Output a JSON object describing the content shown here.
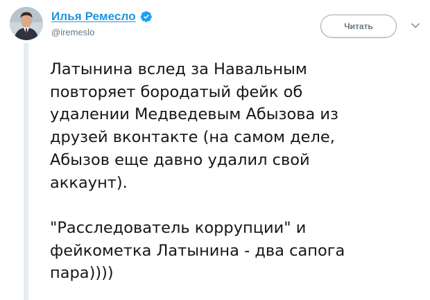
{
  "author": {
    "display_name": "Илья Ремесло",
    "handle": "@iremeslo",
    "verified": true
  },
  "follow_button": {
    "label": "Читать"
  },
  "tweet": {
    "paragraphs": [
      "Латынина вслед за Навальным\nповторяет бородатый фейк об\nудалении Медведевым Абызова из\nдрузей вконтакте (на самом деле,\nАбызов еще давно удалил свой\nаккаунт).",
      "\"Расследователь коррупции\" и\nфейкометка Латынина - два сапога\nпара))))"
    ]
  },
  "icons": {
    "verified": "verified-badge-icon",
    "menu": "chevron-down-icon"
  },
  "colors": {
    "link_blue": "#1b95e0",
    "text": "#14171a",
    "muted": "#657786",
    "quote_bar": "#e6ecf0"
  }
}
